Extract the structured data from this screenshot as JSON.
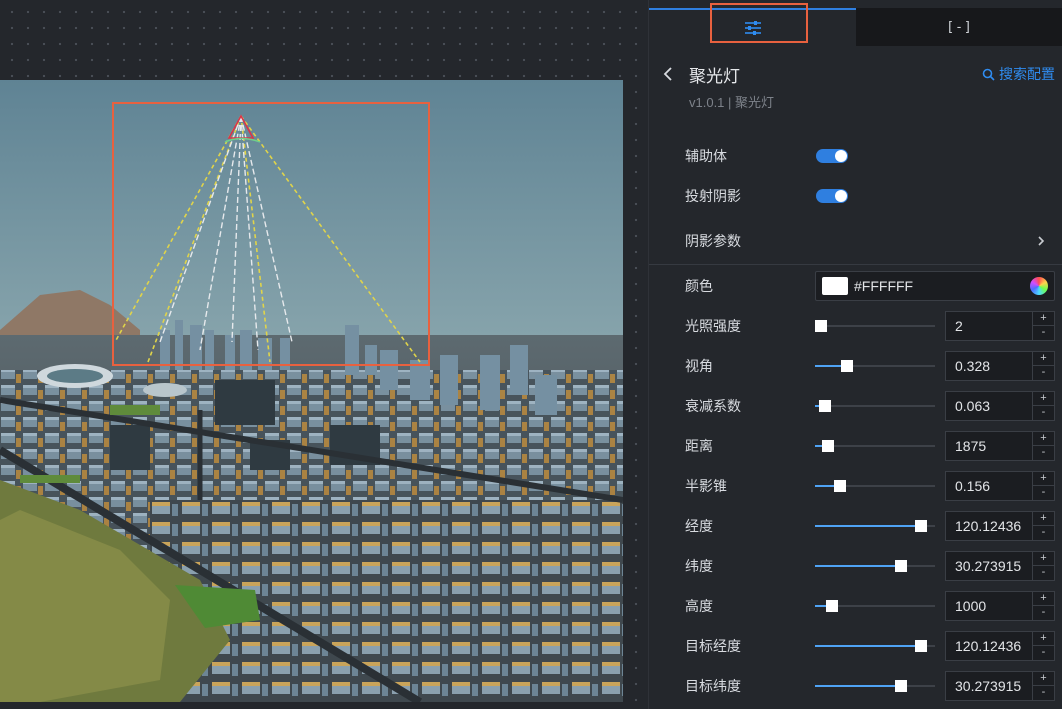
{
  "tabs": {
    "code_glyph": "[-]"
  },
  "header": {
    "title": "聚光灯",
    "subtitle": "v1.0.1 | 聚光灯",
    "search_label": "搜索配置"
  },
  "settings": {
    "helper_label": "辅助体",
    "helper_on": true,
    "shadow_label": "投射阴影",
    "shadow_on": true,
    "shadow_params_label": "阴影参数",
    "color_label": "颜色",
    "color_value": "#FFFFFF",
    "sliders": [
      {
        "label": "光照强度",
        "value": "2",
        "level": 0.0
      },
      {
        "label": "视角",
        "value": "0.328",
        "level": 0.22
      },
      {
        "label": "衰减系数",
        "value": "0.063",
        "level": 0.03
      },
      {
        "label": "距离",
        "value": "1875",
        "level": 0.06
      },
      {
        "label": "半影锥",
        "value": "0.156",
        "level": 0.16
      },
      {
        "label": "经度",
        "value": "120.12436",
        "level": 0.83
      },
      {
        "label": "纬度",
        "value": "30.273915",
        "level": 0.67
      },
      {
        "label": "高度",
        "value": "1000",
        "level": 0.09
      },
      {
        "label": "目标经度",
        "value": "120.12436",
        "level": 0.83
      },
      {
        "label": "目标纬度",
        "value": "30.273915",
        "level": 0.67
      }
    ],
    "plus": "+",
    "minus": "-"
  },
  "colors": {
    "accent": "#2f7fe0",
    "highlight": "#e8613f",
    "panel_bg": "#24272c"
  }
}
